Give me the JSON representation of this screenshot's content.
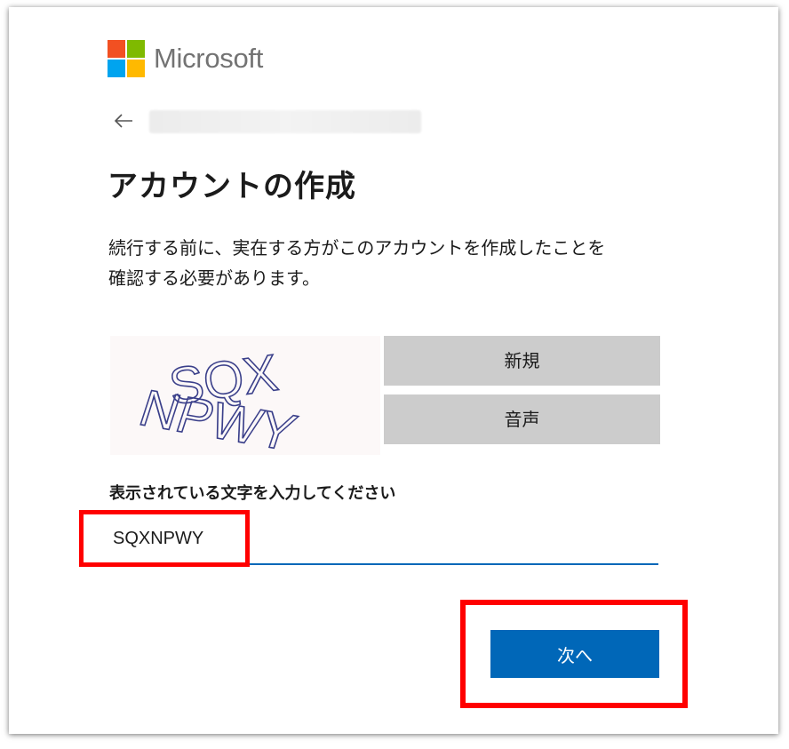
{
  "brand": {
    "name": "Microsoft",
    "colors": {
      "red": "#f25022",
      "green": "#7fba00",
      "blue": "#00a4ef",
      "yellow": "#ffb900"
    }
  },
  "nav": {
    "back_icon": "arrow-left-icon"
  },
  "page": {
    "title": "アカウントの作成",
    "description_line1": "続行する前に、実在する方がこのアカウントを作成したことを",
    "description_line2": "確認する必要があります。"
  },
  "captcha": {
    "image_text_line1": "SQX",
    "image_text_line2": "NPWY",
    "new_button": "新規",
    "audio_button": "音声",
    "field_label": "表示されている文字を入力してください",
    "input_value": "SQXNPWY"
  },
  "actions": {
    "next_label": "次へ"
  },
  "accent_color": "#0067b8",
  "highlight_color": "#ff0000"
}
